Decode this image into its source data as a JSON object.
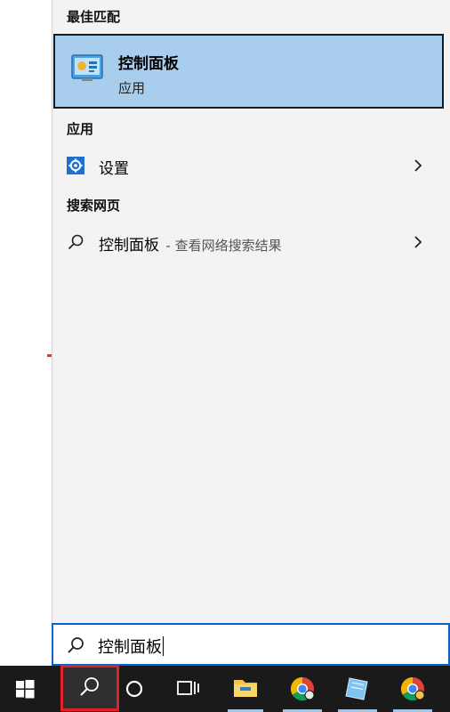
{
  "best_match": {
    "section": "最佳匹配",
    "title": "控制面板",
    "subtitle": "应用",
    "icon": "control-panel-icon"
  },
  "apps": {
    "section": "应用",
    "items": [
      {
        "label": "设置",
        "icon": "settings-gear-icon"
      }
    ]
  },
  "web": {
    "section": "搜索网页",
    "items": [
      {
        "label": "控制面板",
        "hint": "- 查看网络搜索结果",
        "icon": "search-icon"
      }
    ]
  },
  "search_box": {
    "value": "控制面板"
  },
  "taskbar": {
    "items": [
      "start-windows-icon",
      "search-icon",
      "cortana-circle-icon",
      "task-view-icon",
      "file-explorer-icon",
      "chrome-icon",
      "notepad-icon",
      "chrome-profile-icon"
    ]
  },
  "colors": {
    "selection": "#a9cdec",
    "accent": "#0a64c8",
    "taskbar": "#1a1a1a",
    "highlight_box": "#e0202a"
  }
}
